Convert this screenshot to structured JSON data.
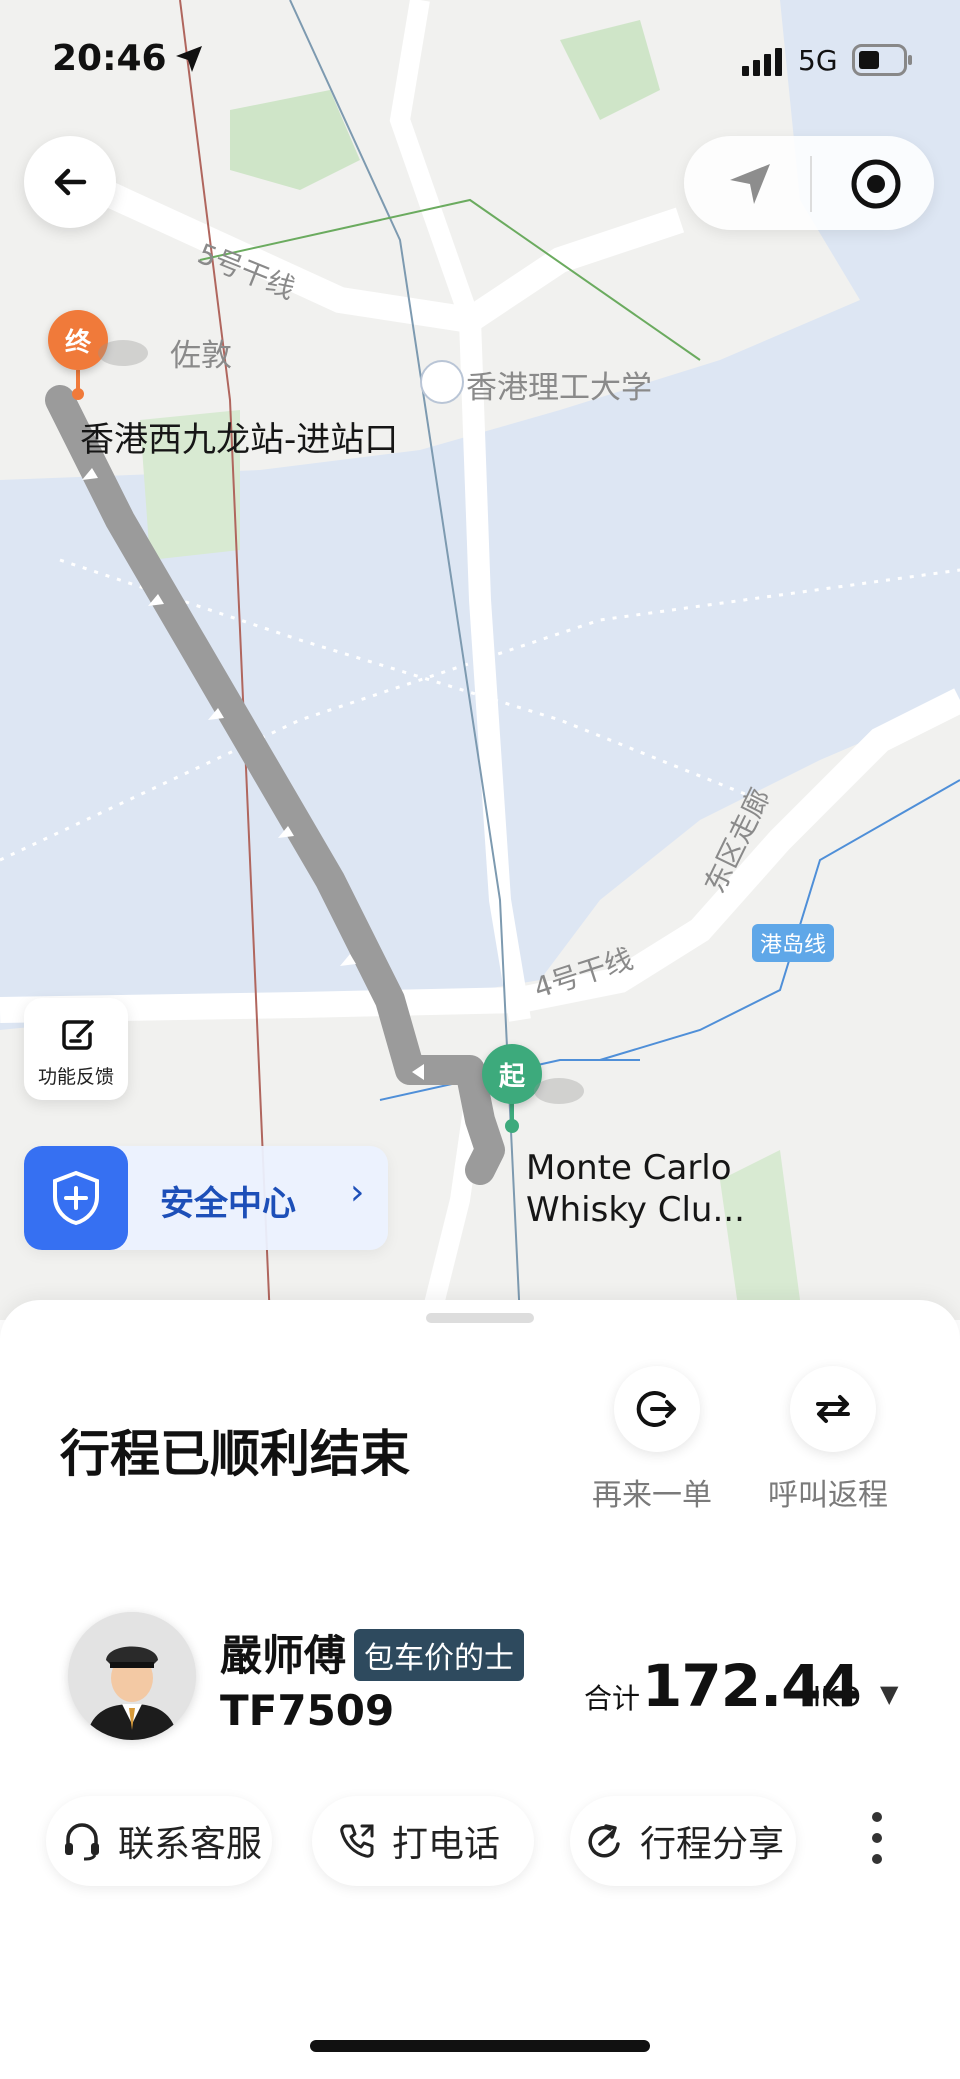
{
  "status_bar": {
    "time": "20:46",
    "network": "5G"
  },
  "map": {
    "labels": {
      "road_5": "5号干线",
      "district_zuodun": "佐敦",
      "university": "香港理工大学",
      "destination": "香港西九龙站-进站口",
      "road_east": "东区走廊",
      "road_4": "4号干线",
      "line_island": "港岛线",
      "origin_line1": "Monte Carlo",
      "origin_line2": "Whisky Clu..."
    },
    "markers": {
      "end": "终",
      "start": "起"
    },
    "route_color": "#9b9b9b",
    "water_color": "#dde6f3"
  },
  "feedback": {
    "label": "功能反馈"
  },
  "safety": {
    "label": "安全中心"
  },
  "sheet": {
    "title": "行程已顺利结束",
    "actions": [
      {
        "label": "再来一单",
        "icon": "reorder-icon"
      },
      {
        "label": "呼叫返程",
        "icon": "return-trip-icon"
      }
    ],
    "driver": {
      "name": "嚴师傅",
      "badge": "包车价的士",
      "plate": "TF7509"
    },
    "fare": {
      "label": "合计",
      "amount": "172.44",
      "currency": "HKD"
    },
    "buttons": [
      {
        "label": "联系客服",
        "icon": "headset-icon"
      },
      {
        "label": "打电话",
        "icon": "phone-icon"
      },
      {
        "label": "行程分享",
        "icon": "share-icon"
      }
    ]
  },
  "colors": {
    "accent_blue": "#3670f2",
    "end_marker": "#f07a3a",
    "start_marker": "#3daa7c",
    "badge": "#2e4a5e"
  }
}
